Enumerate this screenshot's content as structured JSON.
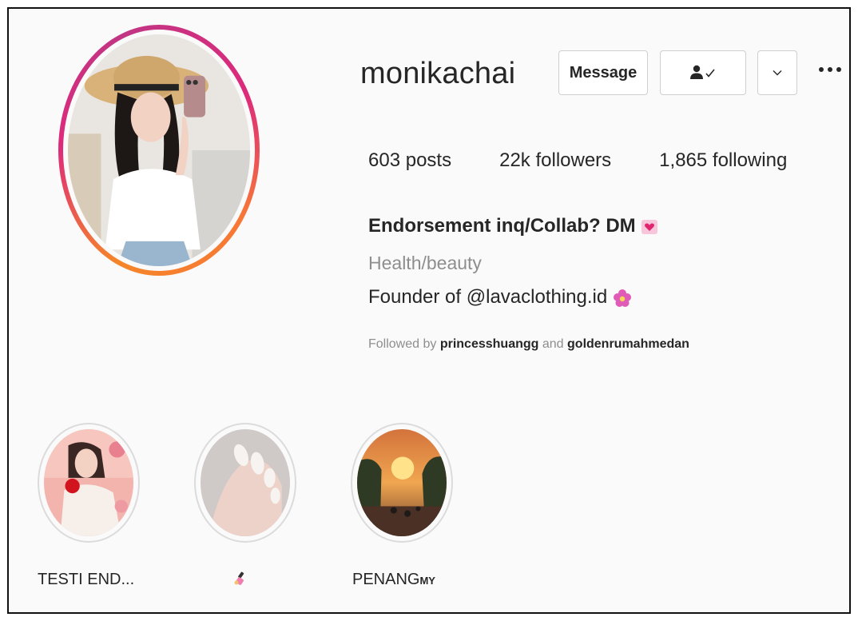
{
  "profile": {
    "username": "monikachai",
    "buttons": {
      "message": "Message"
    },
    "stats": {
      "posts_count": "603",
      "posts_label": "posts",
      "followers_count": "22k",
      "followers_label": "followers",
      "following_count": "1,865",
      "following_label": "following"
    },
    "bio": {
      "name": "Endorsement inq/Collab? DM",
      "category": "Health/beauty",
      "text": "Founder of @lavaclothing.id"
    },
    "followed_by": {
      "prefix": "Followed by",
      "user1": "princesshuangg",
      "conjunction": "and",
      "user2": "goldenrumahmedan"
    }
  },
  "highlights": [
    {
      "label": "TESTI END..."
    },
    {
      "label": ""
    },
    {
      "label": "PENANG",
      "suffix": "MY"
    }
  ],
  "icons": {
    "following": "person-check-icon",
    "dropdown": "chevron-down-icon",
    "more": "more-options-icon",
    "bio_emoji": "heart-icon",
    "flower": "flower-icon"
  },
  "colors": {
    "ring_gradient": [
      "#f58529",
      "#dd2a7b",
      "#c13584"
    ],
    "category_gray": "#8e8e8e",
    "text": "#262626"
  }
}
